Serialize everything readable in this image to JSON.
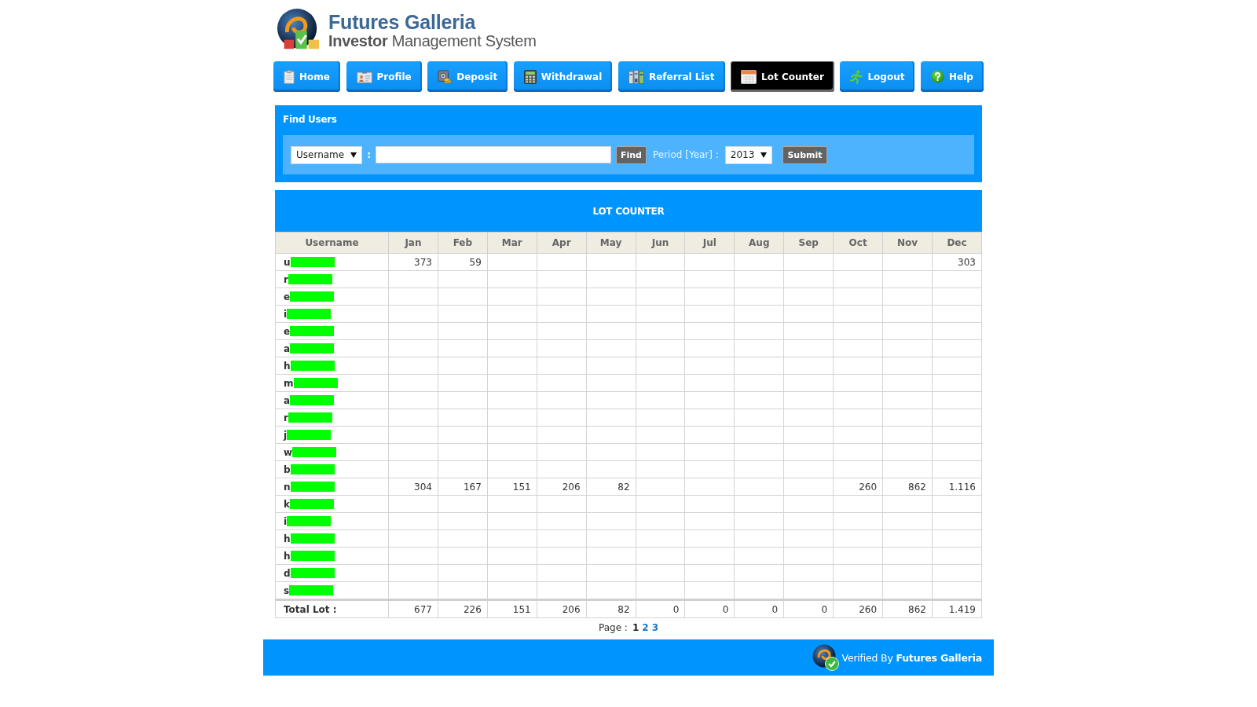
{
  "header": {
    "title": "Futures Galleria",
    "subtitle": "**Investor** Management System"
  },
  "nav": {
    "items": [
      {
        "label": "Home",
        "selected": false
      },
      {
        "label": "Profile",
        "selected": false
      },
      {
        "label": "Deposit",
        "selected": false
      },
      {
        "label": "Withdrawal",
        "selected": false
      },
      {
        "label": "Referral List",
        "selected": false
      },
      {
        "label": "Lot Counter",
        "selected": true
      },
      {
        "label": "Logout",
        "selected": false
      },
      {
        "label": "Help",
        "selected": false
      }
    ]
  },
  "find_users": {
    "title": "Find Users",
    "field_select": "Username",
    "separator": ":",
    "find_button": "Find",
    "period_label": "Period [Year] :",
    "year_select": "2013",
    "submit_button": "Submit"
  },
  "lot_counter": {
    "title": "LOT COUNTER",
    "columns": [
      "Username",
      "Jan",
      "Feb",
      "Mar",
      "Apr",
      "May",
      "Jun",
      "Jul",
      "Aug",
      "Sep",
      "Oct",
      "Nov",
      "Dec"
    ],
    "rows": [
      {
        "username": "u",
        "redacted": true,
        "cells": [
          "373",
          "59",
          null,
          null,
          null,
          null,
          null,
          null,
          null,
          null,
          null,
          "303"
        ]
      },
      {
        "username": "r",
        "redacted": true
      },
      {
        "username": "e",
        "redacted": true
      },
      {
        "username": "i",
        "redacted": true
      },
      {
        "username": "e",
        "redacted": true
      },
      {
        "username": "a",
        "redacted": true
      },
      {
        "username": "h",
        "redacted": true
      },
      {
        "username": "m",
        "redacted": true
      },
      {
        "username": "a",
        "redacted": true
      },
      {
        "username": "r",
        "redacted": true
      },
      {
        "username": "j",
        "redacted": true
      },
      {
        "username": "w",
        "redacted": true
      },
      {
        "username": "b",
        "redacted": true
      },
      {
        "username": "n",
        "redacted": true,
        "cells": [
          "304",
          "167",
          "151",
          "206",
          "82",
          null,
          null,
          null,
          null,
          "260",
          "862",
          "1.116"
        ]
      },
      {
        "username": "k",
        "redacted": true
      },
      {
        "username": "i",
        "redacted": true
      },
      {
        "username": "h",
        "redacted": true
      },
      {
        "username": "h",
        "redacted": true
      },
      {
        "username": "d",
        "redacted": true
      },
      {
        "username": "s",
        "redacted": true
      }
    ],
    "total": {
      "label": "Total Lot :",
      "cells": [
        "677",
        "226",
        "151",
        "206",
        "82",
        "0",
        "0",
        "0",
        "0",
        "260",
        "862",
        "1.419"
      ]
    }
  },
  "pagination": {
    "label": "Page :",
    "pages": [
      {
        "label": "1",
        "selected": true
      },
      {
        "label": "2",
        "selected": false
      },
      {
        "label": "3",
        "selected": false
      }
    ]
  },
  "footer": {
    "text": "Verified By **Futures Galleria**"
  }
}
